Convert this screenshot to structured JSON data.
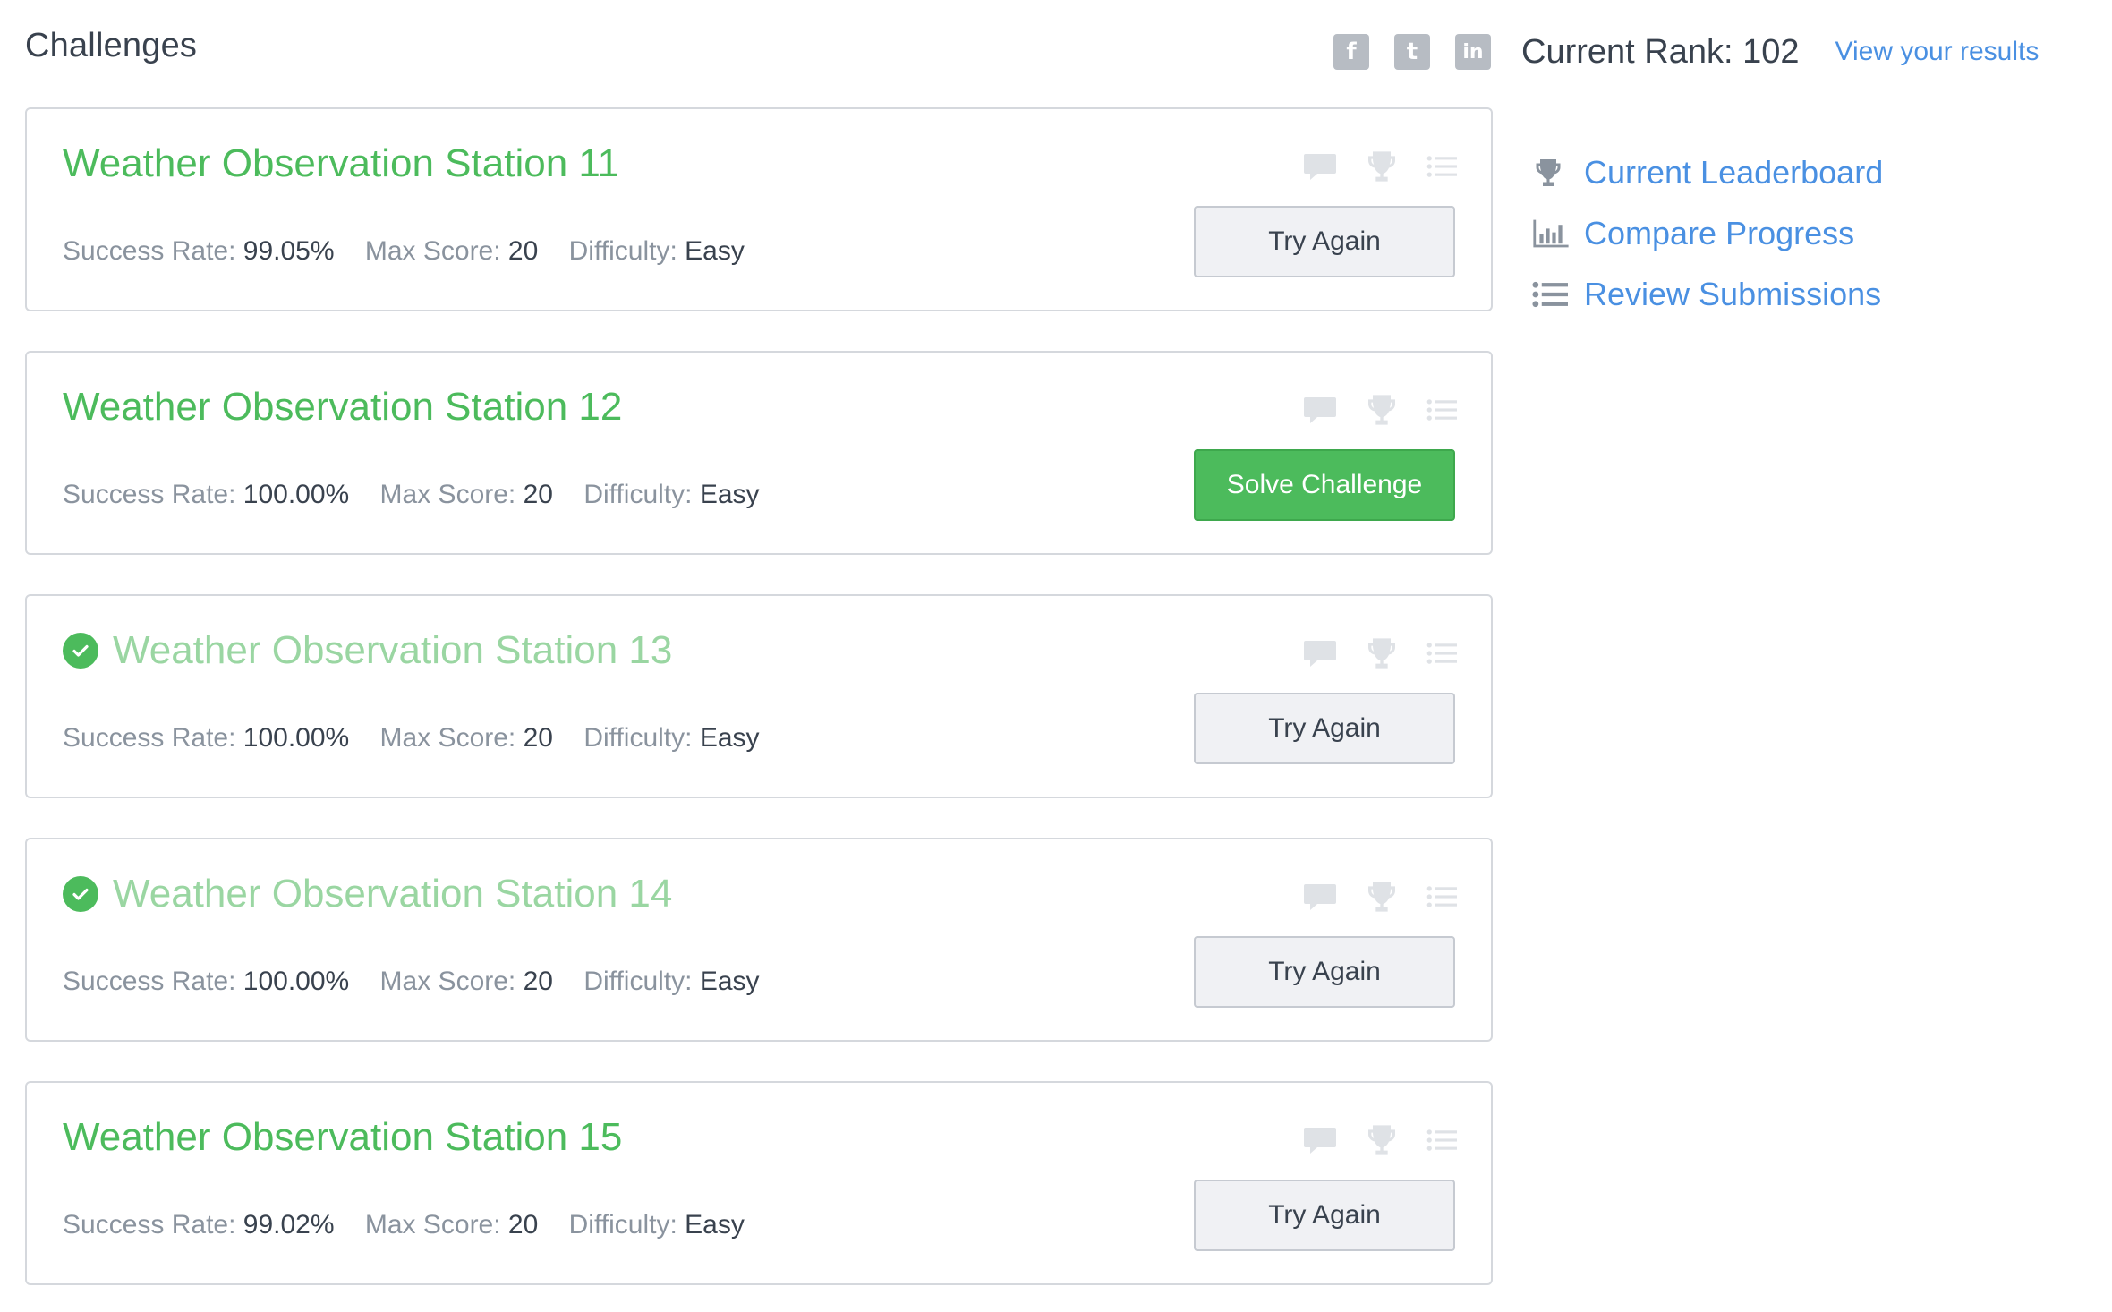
{
  "header": {
    "title": "Challenges",
    "rank_label": "Current Rank: 102",
    "view_results": "View your results",
    "social": [
      {
        "icon": "facebook-icon",
        "glyph": "f"
      },
      {
        "icon": "twitter-icon",
        "glyph": "t"
      },
      {
        "icon": "linkedin-icon",
        "glyph": "in"
      }
    ]
  },
  "labels": {
    "success_rate": "Success Rate: ",
    "max_score": "Max Score: ",
    "difficulty": "Difficulty: "
  },
  "challenges": [
    {
      "title": "Weather Observation Station 11",
      "solved": false,
      "success_rate": "99.05%",
      "max_score": "20",
      "difficulty": "Easy",
      "button": "Try Again",
      "primary": false
    },
    {
      "title": "Weather Observation Station 12",
      "solved": false,
      "success_rate": "100.00%",
      "max_score": "20",
      "difficulty": "Easy",
      "button": "Solve Challenge",
      "primary": true
    },
    {
      "title": "Weather Observation Station 13",
      "solved": true,
      "success_rate": "100.00%",
      "max_score": "20",
      "difficulty": "Easy",
      "button": "Try Again",
      "primary": false
    },
    {
      "title": "Weather Observation Station 14",
      "solved": true,
      "success_rate": "100.00%",
      "max_score": "20",
      "difficulty": "Easy",
      "button": "Try Again",
      "primary": false
    },
    {
      "title": "Weather Observation Station 15",
      "solved": false,
      "success_rate": "99.02%",
      "max_score": "20",
      "difficulty": "Easy",
      "button": "Try Again",
      "primary": false
    }
  ],
  "sidebar": {
    "links": [
      {
        "label": "Current Leaderboard",
        "icon": "trophy-icon"
      },
      {
        "label": "Compare Progress",
        "icon": "bar-chart-icon"
      },
      {
        "label": "Review Submissions",
        "icon": "list-icon"
      }
    ]
  },
  "colors": {
    "accent_green": "#4cbb5c",
    "solved_green": "#9ad6a2",
    "link_blue": "#4a90e2",
    "text_dark": "#39424e",
    "text_muted": "#8a939e"
  }
}
